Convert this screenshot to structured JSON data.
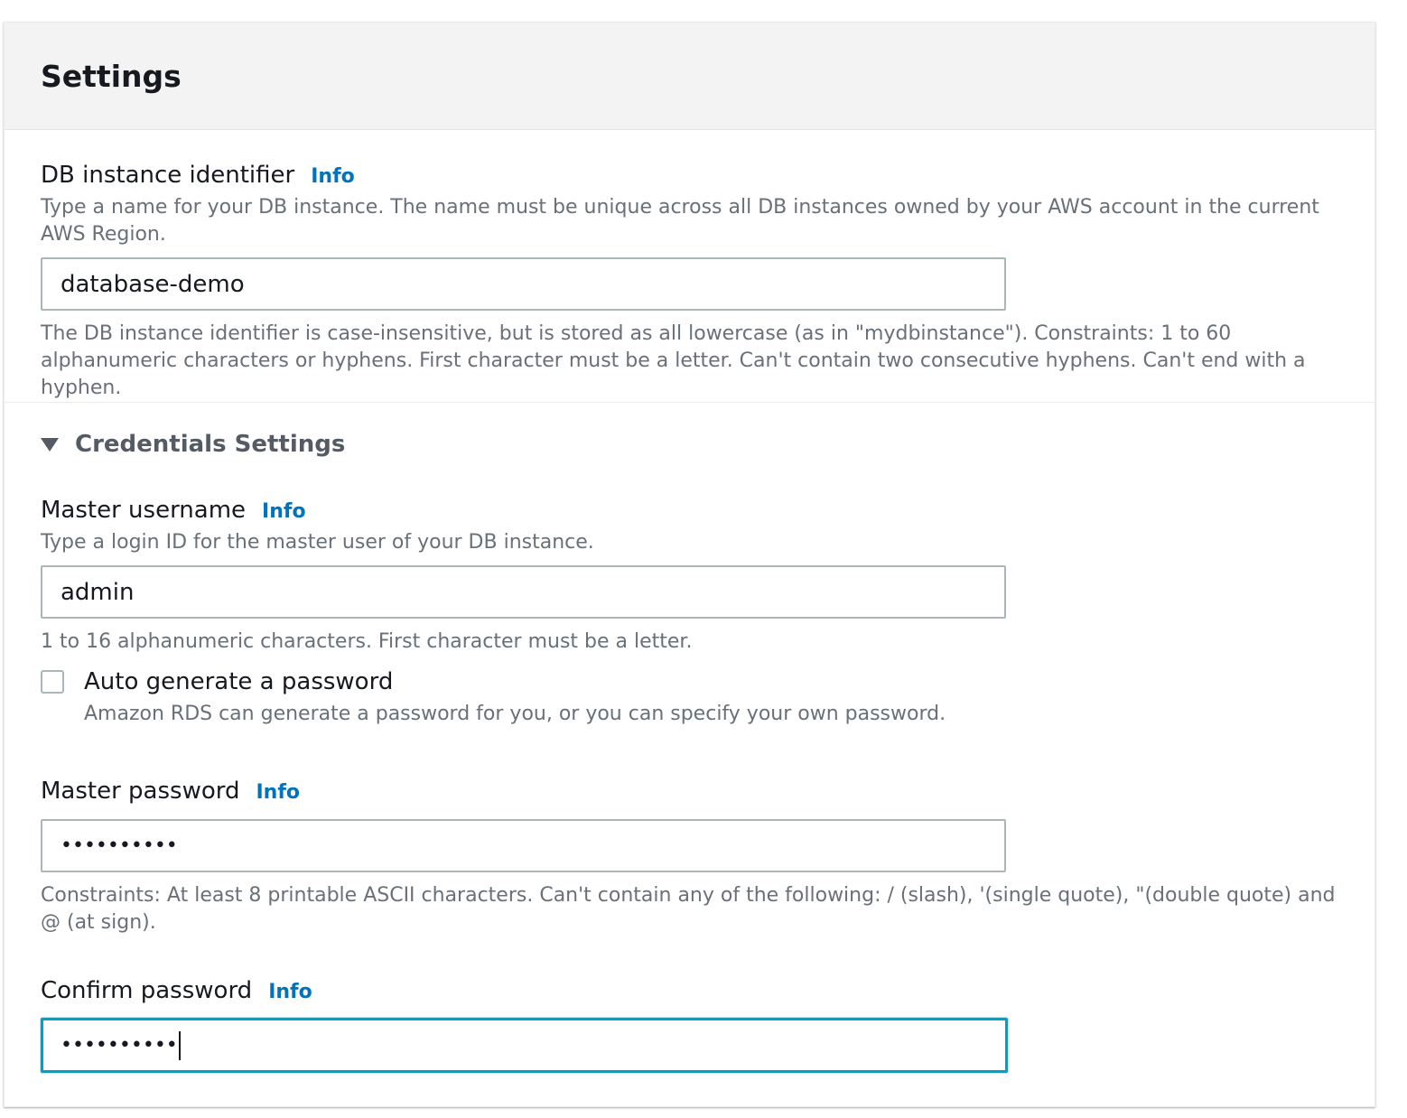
{
  "panel": {
    "title": "Settings"
  },
  "db_identifier": {
    "label": "DB instance identifier",
    "info": "Info",
    "description": "Type a name for your DB instance. The name must be unique across all DB instances owned by your AWS account in the current AWS Region.",
    "value": "database-demo",
    "constraint": "The DB instance identifier is case-insensitive, but is stored as all lowercase (as in \"mydbinstance\"). Constraints: 1 to 60 alphanumeric characters or hyphens. First character must be a letter. Can't contain two consecutive hyphens. Can't end with a hyphen."
  },
  "credentials": {
    "title": "Credentials Settings",
    "master_username": {
      "label": "Master username",
      "info": "Info",
      "description": "Type a login ID for the master user of your DB instance.",
      "value": "admin",
      "constraint": "1 to 16 alphanumeric characters. First character must be a letter."
    },
    "auto_generate": {
      "label": "Auto generate a password",
      "description": "Amazon RDS can generate a password for you, or you can specify your own password.",
      "checked": false
    },
    "master_password": {
      "label": "Master password",
      "info": "Info",
      "value": "••••••••••",
      "constraint": "Constraints: At least 8 printable ASCII characters. Can't contain any of the following: / (slash), '(single quote), \"(double quote) and @ (at sign)."
    },
    "confirm_password": {
      "label": "Confirm password",
      "info": "Info",
      "value": "••••••••••"
    }
  }
}
